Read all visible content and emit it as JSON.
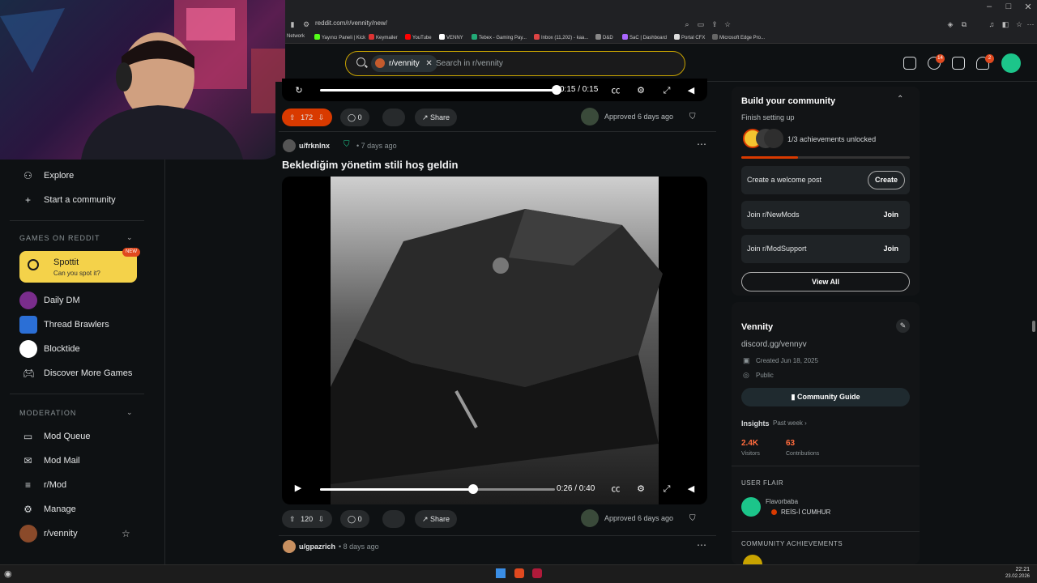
{
  "browser": {
    "url": "reddit.com/r/vennity/new/",
    "bookmarks": [
      "Network",
      "Yayıncı Paneli | Kick",
      "Keymailer",
      "YouTube",
      "VENNY",
      "Tebex - Gaming Pay...",
      "Inbox (11,202) - kaa...",
      "D&D",
      "SaC | Dashboard",
      "Portal CFX",
      "Microsoft Edge Pro..."
    ]
  },
  "header": {
    "search_chip": "r/vennity",
    "search_placeholder": "Search in r/vennity",
    "chat_badge": "14",
    "notif_badge": "2"
  },
  "sidebar": {
    "explore": "Explore",
    "start_community": "Start a community",
    "games_heading": "GAMES ON REDDIT",
    "spottit_title": "Spottit",
    "spottit_sub": "Can you spot it?",
    "new_badge": "NEW",
    "games": [
      "Daily DM",
      "Thread Brawlers",
      "Blocktide",
      "Discover More Games"
    ],
    "moderation_heading": "MODERATION",
    "mod_items": [
      "Mod Queue",
      "Mod Mail",
      "r/Mod",
      "Manage"
    ],
    "community": "r/vennity"
  },
  "feed": {
    "top_video_time": "0:15 / 0:15",
    "post1": {
      "votes": "172",
      "comments": "0",
      "share": "Share",
      "approved": "Approved 6 days ago"
    },
    "post2": {
      "author": "u/frknlnx",
      "age": "• 7 days ago",
      "title": "Beklediğim yönetim stili hoş geldin",
      "video_time": "0:26 / 0:40",
      "progress": 0.65,
      "votes": "120",
      "comments": "0",
      "share": "Share",
      "approved": "Approved 6 days ago"
    },
    "post3": {
      "author": "u/gpazrich",
      "age": "• 8 days ago"
    }
  },
  "right": {
    "build_title": "Build your community",
    "finish": "Finish setting up",
    "achievements": "1/3 achievements unlocked",
    "tasks": [
      {
        "label": "Create a welcome post",
        "action": "Create"
      },
      {
        "label": "Join r/NewMods",
        "action": "Join"
      },
      {
        "label": "Join r/ModSupport",
        "action": "Join"
      }
    ],
    "view_all": "View All",
    "community_name": "Vennity",
    "community_link": "discord.gg/vennyv",
    "created": "Created Jun 18, 2025",
    "visibility": "Public",
    "guide": "Community Guide",
    "insights": "Insights",
    "insights_range": "Past week ›",
    "visitors_val": "2.4K",
    "visitors_label": "Visitors",
    "contrib_val": "63",
    "contrib_label": "Contributions",
    "user_flair_heading": "USER FLAIR",
    "flair_user": "Flavorbaba",
    "flair_text": "REİS-İ CUMHUR",
    "achievements_heading": "COMMUNITY ACHIEVEMENTS"
  },
  "taskbar": {
    "time": "22:21",
    "date": "23.02.2026"
  },
  "colors": {
    "accent": "#e0491f",
    "brand_green": "#1cc58a",
    "search_border": "#c8a300"
  }
}
